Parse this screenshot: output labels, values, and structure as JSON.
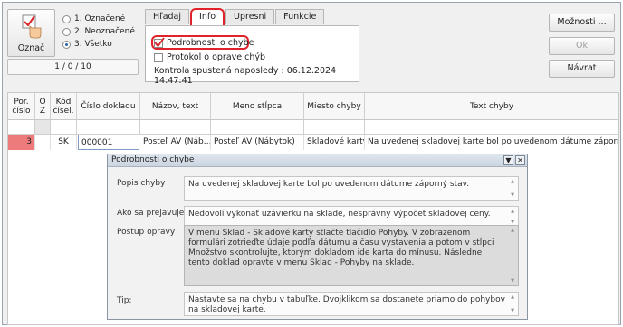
{
  "oznac": {
    "label": "Označ"
  },
  "filter_radios": [
    {
      "label": "1. Označené",
      "selected": false
    },
    {
      "label": "2. Neoznačené",
      "selected": false
    },
    {
      "label": "3. Všetko",
      "selected": true
    }
  ],
  "record_counter": "1 / 0 / 10",
  "tabs": [
    {
      "label": "Hľadaj",
      "active": false
    },
    {
      "label": "Info",
      "active": true
    },
    {
      "label": "Upresni",
      "active": false
    },
    {
      "label": "Funkcie",
      "active": false
    }
  ],
  "info_panel": {
    "details_label": "Podrobnosti o chybe",
    "details_checked": true,
    "protocol_label": "Protokol o oprave chýb",
    "protocol_checked": false,
    "last_run": "Kontrola spustená naposledy : 06.12.2024 14:47:41"
  },
  "side_buttons": {
    "moznosti": "Možnosti ...",
    "ok": "Ok",
    "navrat": "Návrat"
  },
  "grid": {
    "headers": [
      "Por. číslo",
      "O Z",
      "Kód čísel.",
      "Číslo dokladu",
      "Názov, text",
      "Meno stĺpca",
      "Miesto chyby",
      "Text chyby"
    ],
    "row": {
      "por": "3",
      "oz": "",
      "kod": "SK",
      "cislo": "000001",
      "nazov": "Posteľ AV (Náb…",
      "meno": "Posteľ AV (Nábytok)",
      "miesto": "Skladové karty",
      "text": "Na uvedenej skladovej karte bol po uvedenom dátume záporný stav."
    }
  },
  "popup": {
    "title": "Podrobnosti o chybe",
    "popis_label": "Popis chyby",
    "popis_text": "Na uvedenej skladovej karte bol po uvedenom dátume záporný stav.",
    "prejav_label": "Ako sa prejavuje",
    "prejav_text": "Nedovolí vykonať uzávierku na sklade, nesprávny výpočet skladovej ceny.",
    "postup_label": "Postup opravy",
    "postup_text": "V menu Sklad - Skladové karty stlačte tlačidlo Pohyby. V zobrazenom formulári zotrieďte údaje podľa dátumu a času vystavenia a potom v stĺpci Množstvo skontrolujte, ktorým dokladom ide karta do mínusu. Následne tento doklad opravte v menu Sklad - Pohyby na sklade.",
    "tip_label": "Tip:",
    "tip_text": "Nastavte sa na chybu v tabuľke. Dvojklikom sa dostanete priamo do pohybov na skladovej karte."
  },
  "colors": {
    "highlight": "#e0222a",
    "error_cell": "#ee7b7b",
    "selected_radio": "#2a5fa6"
  }
}
